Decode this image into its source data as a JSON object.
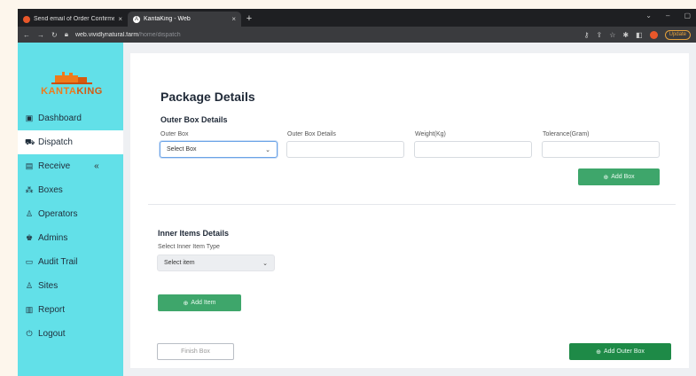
{
  "browser": {
    "tabs": [
      {
        "title": "Send email of Order Confirmed",
        "close": "×",
        "active": false,
        "fav_color": "#e8572a"
      },
      {
        "title": "KantaKing - Web",
        "close": "×",
        "active": true,
        "fav_color": "#ffffff"
      }
    ],
    "new_tab": "+",
    "controls": {
      "minimize": "–",
      "maximize": "▢",
      "chevron": "⌄"
    },
    "url_host": "web.vividlynatural.farm",
    "url_path": "/home/dispatch",
    "update_label": "Update"
  },
  "brand": {
    "name_a": "KANTA",
    "name_b": "KING"
  },
  "sidebar": {
    "items": [
      {
        "label": "Dashboard",
        "icon": "▣"
      },
      {
        "label": "Dispatch",
        "icon": "⛟"
      },
      {
        "label": "Receive",
        "icon": "▤",
        "extra": "«"
      },
      {
        "label": "Boxes",
        "icon": "⁂"
      },
      {
        "label": "Operators",
        "icon": "♙"
      },
      {
        "label": "Admins",
        "icon": "♚"
      },
      {
        "label": "Audit Trail",
        "icon": "▭"
      },
      {
        "label": "Sites",
        "icon": "♙"
      },
      {
        "label": "Report",
        "icon": "▥"
      },
      {
        "label": "Logout",
        "icon": "⏻"
      }
    ]
  },
  "main": {
    "title": "Package Details",
    "outer_title": "Outer Box Details",
    "outer_box_label": "Outer Box",
    "outer_box_value": "Select Box",
    "outer_details_label": "Outer Box Details",
    "outer_details_value": "",
    "weight_label": "Weight(Kg)",
    "weight_value": "",
    "tolerance_label": "Tolerance(Gram)",
    "tolerance_value": "",
    "add_box": "Add Box",
    "inner_title": "Inner Items Details",
    "inner_type_label": "Select Inner Item Type",
    "inner_type_value": "Select item",
    "add_item": "Add Item",
    "finish_box": "Finish Box",
    "add_outer_box": "Add Outer Box"
  },
  "colors": {
    "sidebar": "#62e0e8",
    "accent_green": "#3ea66b",
    "accent_dark_green": "#1e8a47",
    "brand_orange": "#f07a1a"
  }
}
